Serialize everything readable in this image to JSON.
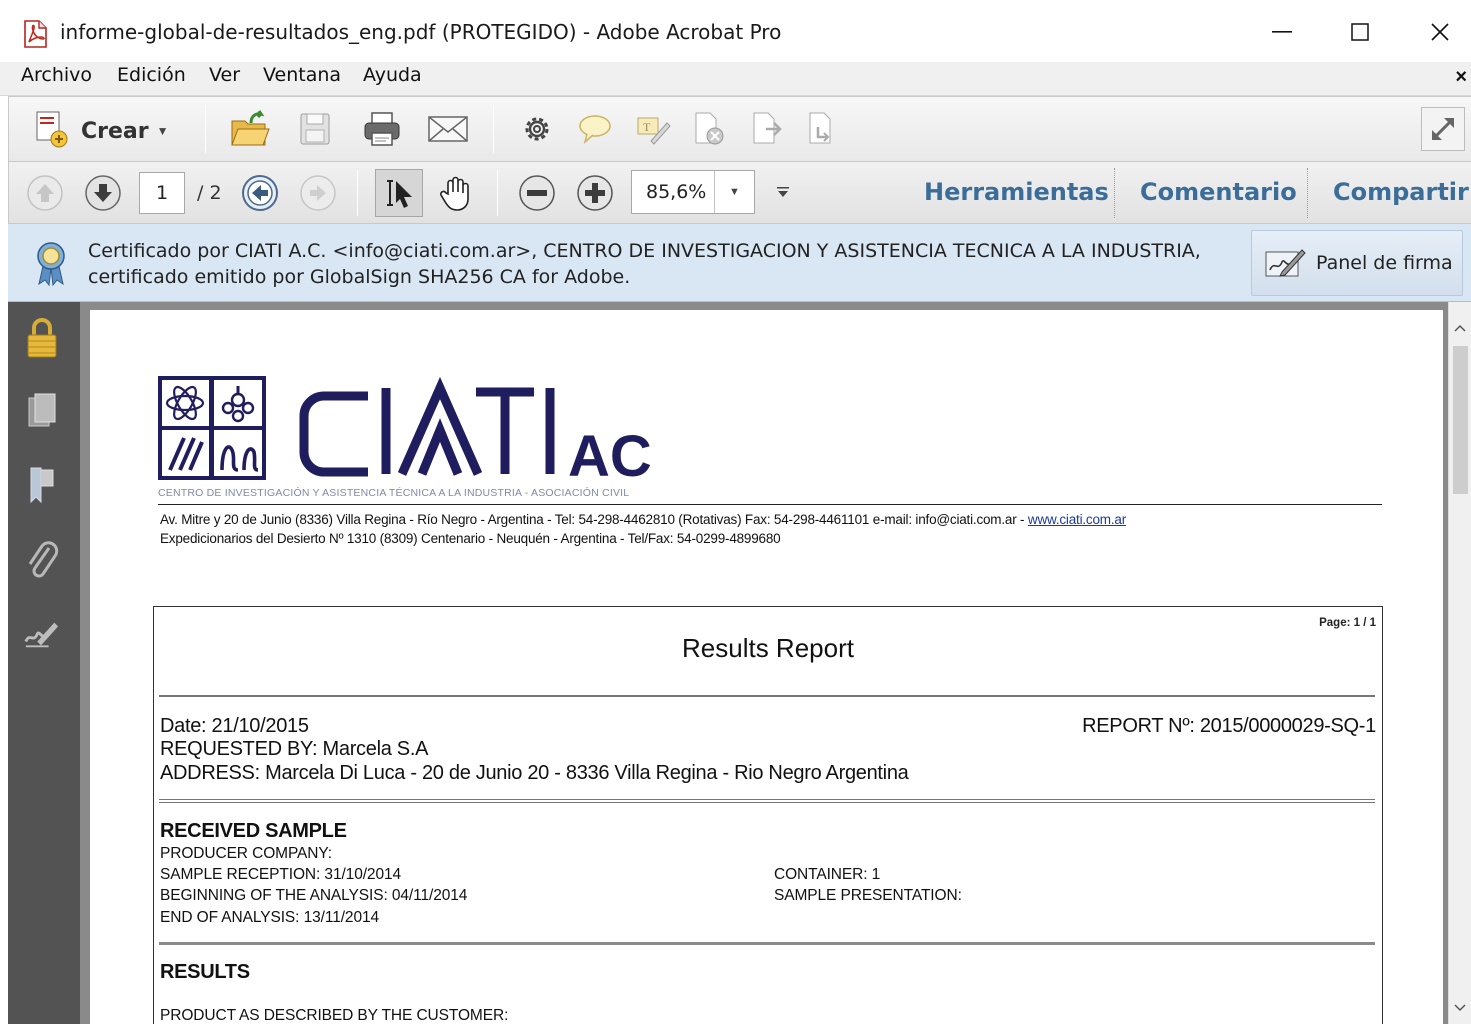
{
  "window": {
    "title": "informe-global-de-resultados_eng.pdf (PROTEGIDO) - Adobe Acrobat Pro",
    "minimize": "—",
    "maximize": "☐",
    "close": "✕"
  },
  "menu": {
    "items": [
      "Archivo",
      "Edición",
      "Ver",
      "Ventana",
      "Ayuda"
    ],
    "close_doc": "×"
  },
  "toolbar": {
    "create_label": "Crear",
    "page_current": "1",
    "page_total": "/ 2",
    "zoom": "85,6%",
    "tabs": [
      "Herramientas",
      "Comentario",
      "Compartir"
    ]
  },
  "certificate": {
    "message_line1": "Certificado por CIATI A.C. <info@ciati.com.ar>, CENTRO DE INVESTIGACION Y ASISTENCIA TECNICA A LA INDUSTRIA,",
    "message_line2": "certificado emitido por GlobalSign SHA256 CA for Adobe.",
    "panel_button": "Panel de firma"
  },
  "document": {
    "logo_text": "CIATI",
    "logo_suffix": "AC",
    "logo_subtitle": "CENTRO DE INVESTIGACIÓN Y ASISTENCIA TÉCNICA A LA INDUSTRIA - ASOCIACIÓN CIVIL",
    "address_line1": "Av. Mitre y 20 de Junio (8336) Villa Regina - Río Negro - Argentina - Tel: 54-298-4462810 (Rotativas) Fax: 54-298-4461101 e-mail: info@ciati.com.ar - ",
    "address_link": "www.ciati.com.ar",
    "address_line2": "Expedicionarios del Desierto Nº 1310 (8309) Centenario - Neuquén - Argentina - Tel/Fax: 54-0299-4899680",
    "page_label": "Page: 1 / 1",
    "report_title": "Results Report",
    "date": "Date: 21/10/2015",
    "report_no": "REPORT Nº: 2015/0000029-SQ-1",
    "requested_by": "REQUESTED BY: Marcela S.A",
    "address": "ADDRESS: Marcela Di Luca - 20 de Junio 20 - 8336 Villa Regina - Rio Negro Argentina",
    "received_heading": "RECEIVED SAMPLE",
    "producer": "PRODUCER COMPANY:",
    "reception": "SAMPLE RECEPTION: 31/10/2014",
    "beginning": "BEGINNING OF THE ANALYSIS: 04/11/2014",
    "end": "END OF ANALYSIS: 13/11/2014",
    "container": "CONTAINER: 1",
    "presentation": "SAMPLE PRESENTATION:",
    "results_heading": "RESULTS",
    "product_desc": "PRODUCT AS DESCRIBED BY THE CUSTOMER:"
  },
  "colors": {
    "tab_text": "#3a6d99",
    "cert_banner": "#d9e6f3",
    "logo_navy": "#1f1d5e",
    "rail": "#535353"
  }
}
